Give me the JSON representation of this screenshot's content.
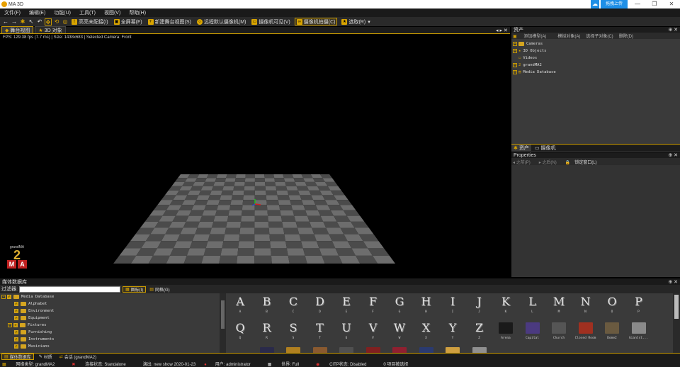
{
  "window": {
    "title": "MA 3D",
    "upload_label": "拖拽上传",
    "controls": [
      "—",
      "❐",
      "✕"
    ]
  },
  "menu": [
    "文件(F)",
    "编辑(E)",
    "功能(U)",
    "工具(T)",
    "视图(V)",
    "帮助(H)"
  ],
  "toolbar": {
    "nav": [
      "←",
      "→"
    ],
    "items": [
      {
        "label": "高亮未配接(I)",
        "selected": false
      },
      {
        "label": "全屏幕(F)",
        "selected": false
      },
      {
        "label": "新建舞台视图(S)",
        "selected": false
      },
      {
        "label": "远程默认摄像机(M)",
        "selected": false
      },
      {
        "label": "摄像机可见(V)",
        "selected": false
      },
      {
        "label": "摄像机拍摄(C)",
        "selected": true
      },
      {
        "label": "选取(R)",
        "selected": false
      }
    ]
  },
  "viewport": {
    "tabs": [
      {
        "label": "舞台视图",
        "active": true
      },
      {
        "label": "3D 对象",
        "active": false
      }
    ],
    "info": "FPS: 129.38 fps (7.7 ms) | Size: 1438x683 | Selected Camera: Front"
  },
  "assets": {
    "title": "资产",
    "toolbar": [
      {
        "label": "添加模型(A)",
        "enabled": true
      },
      {
        "label": "模拟对象(A)",
        "enabled": false
      },
      {
        "label": "选择子对象(C)",
        "enabled": false
      },
      {
        "label": "删除(D)",
        "enabled": false
      }
    ],
    "tree": [
      {
        "label": "Cameras",
        "expandable": true
      },
      {
        "label": "3D Objects",
        "expandable": true
      },
      {
        "label": "Videos",
        "expandable": false
      },
      {
        "label": "grandMA2",
        "expandable": true
      },
      {
        "label": "Media Database",
        "expandable": true
      }
    ],
    "tabs": [
      {
        "label": "资产",
        "active": true
      },
      {
        "label": "摄像机",
        "active": false
      }
    ]
  },
  "properties": {
    "title": "Properties",
    "nav": [
      {
        "label": "之前(P)",
        "enabled": false
      },
      {
        "label": "之后(N)",
        "enabled": false
      },
      {
        "label": "锁定窗口(L)",
        "enabled": true
      }
    ]
  },
  "media": {
    "title": "媒体数据库",
    "filter_label": "过滤器:",
    "filter_value": "",
    "view_buttons": [
      {
        "label": "图标(I)",
        "selected": true
      },
      {
        "label": "网格(G)",
        "selected": false
      }
    ],
    "tree": [
      {
        "label": "Media Database",
        "root": true
      },
      {
        "label": "Alphabet",
        "expandable": false
      },
      {
        "label": "Environment",
        "expandable": false
      },
      {
        "label": "Equipment",
        "expandable": false
      },
      {
        "label": "Fixtures",
        "expandable": true
      },
      {
        "label": "Furnishing",
        "expandable": false
      },
      {
        "label": "Instruments",
        "expandable": false
      },
      {
        "label": "Musicians",
        "expandable": false
      }
    ],
    "letters_row1": [
      "A",
      "B",
      "C",
      "D",
      "E",
      "F",
      "G",
      "H",
      "I",
      "J",
      "K",
      "L",
      "M",
      "N",
      "O",
      "P"
    ],
    "letters_row2": [
      "Q",
      "R",
      "S",
      "T",
      "U",
      "V",
      "W",
      "X",
      "Y",
      "Z"
    ],
    "models_row2": [
      {
        "label": "Arena",
        "color": "#1a1a1a"
      },
      {
        "label": "Capital",
        "color": "#4b3a80"
      },
      {
        "label": "Church",
        "color": "#555555"
      },
      {
        "label": "Closed Room",
        "color": "#a03020"
      },
      {
        "label": "Dome2",
        "color": "#6a5a40"
      },
      {
        "label": "Giantst...",
        "color": "#8a8a8a"
      }
    ],
    "row3_colors": [
      "#2a2a4a",
      "#b08020",
      "#8a5a30",
      "#505050",
      "#802020",
      "#902030",
      "#2a3a70",
      "#d0a040",
      "#909090"
    ]
  },
  "bottom_tabs": [
    {
      "label": "媒体数据库",
      "active": true
    },
    {
      "label": "材质",
      "active": false
    },
    {
      "label": "会话 (grandMA2)",
      "active": false
    }
  ],
  "status": [
    "网络类型: grandMA2",
    "连接状态: Standalone",
    "演出: new show 2020-01-23",
    "用户: administrator",
    "世界: Full",
    "CITP状态: Disabled",
    "0 项目被选择"
  ]
}
